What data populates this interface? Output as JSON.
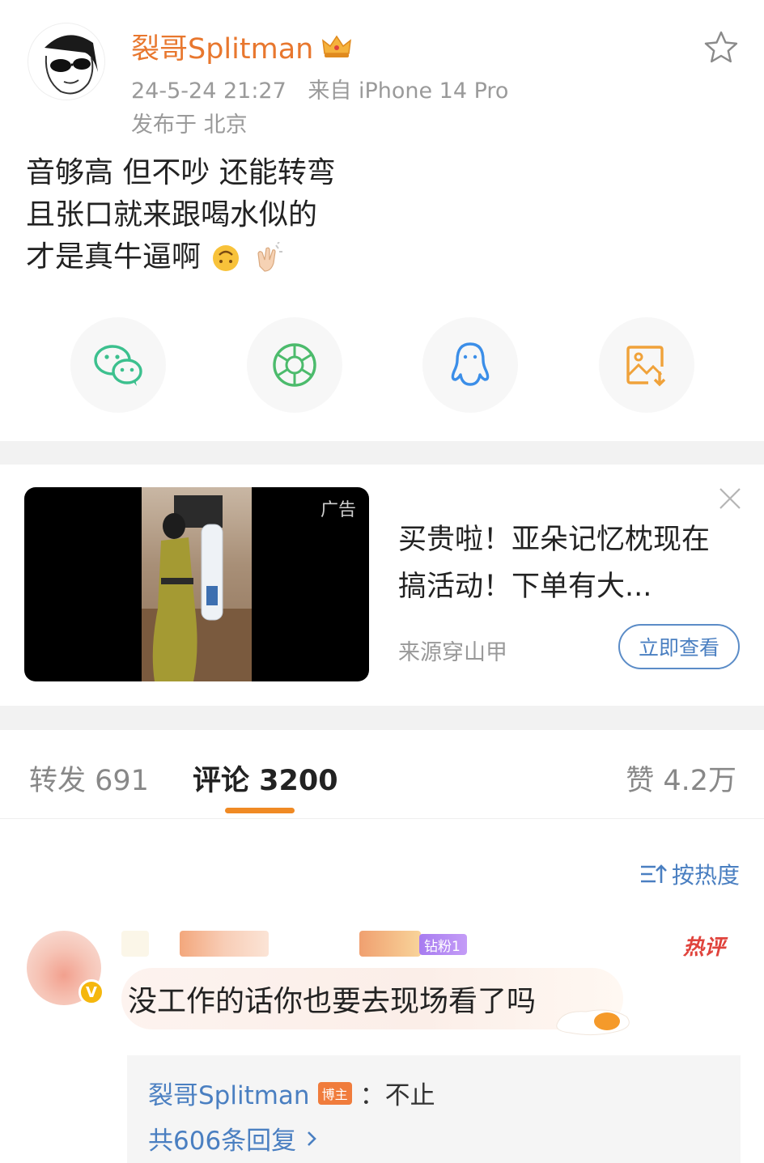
{
  "post": {
    "author": "裂哥Splitman",
    "date": "24-5-24 21:27",
    "source": "来自 iPhone 14 Pro",
    "location": "发布于 北京",
    "content_lines": [
      "音够高 但不吵 还能转弯",
      "且张口就来跟喝水似的",
      "才是真牛逼啊"
    ],
    "icons": {
      "avatar": "cartoon-sunglasses-avatar",
      "badge": "crown-icon",
      "favorite": "star-outline-icon"
    }
  },
  "share": [
    {
      "name": "wechat",
      "icon": "wechat-icon",
      "color": "#3cc08e"
    },
    {
      "name": "moments",
      "icon": "moments-icon",
      "color": "#4cbb6c"
    },
    {
      "name": "qq",
      "icon": "qq-icon",
      "color": "#3b8ee8"
    },
    {
      "name": "save-image",
      "icon": "save-image-icon",
      "color": "#f0a23a"
    }
  ],
  "ad": {
    "tag": "广告",
    "title": "买贵啦！亚朵记忆枕现在搞活动！下单有大...",
    "source": "来源穿山甲",
    "button": "立即查看"
  },
  "tabs": {
    "repost": "转发 691",
    "comments": "评论 3200",
    "likes": "赞 4.2万"
  },
  "sort_label": "按热度",
  "comment": {
    "fan_badge": "钻粉1",
    "hot_tag": "热评",
    "text": "没工作的话你也要去现场看了吗",
    "verified": "V",
    "reply": {
      "author": "裂哥Splitman",
      "owner_badge": "博主",
      "text": "：不止",
      "count": "共606条回复"
    }
  },
  "colors": {
    "accent_orange": "#e8772e",
    "link_blue": "#4a7fc1",
    "tab_underline": "#f08a24",
    "hot_red": "#e0433c"
  }
}
